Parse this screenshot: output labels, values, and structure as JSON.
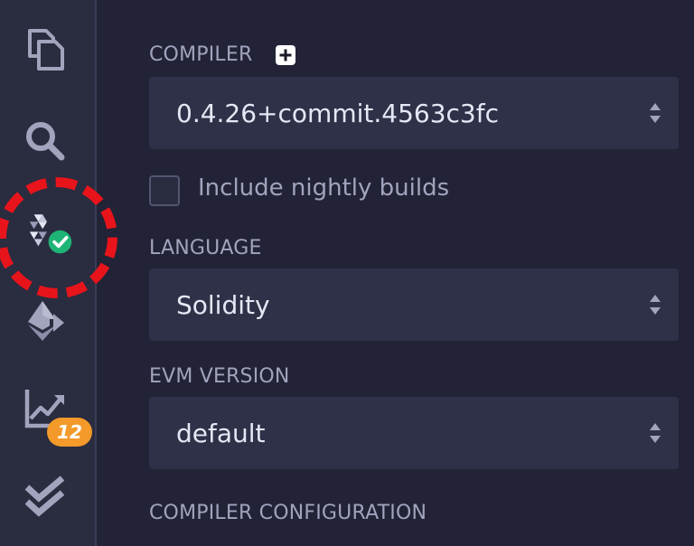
{
  "sidebar": {
    "icons": [
      {
        "name": "file-explorer-icon"
      },
      {
        "name": "search-icon"
      },
      {
        "name": "solidity-compiler-icon",
        "status": "success"
      },
      {
        "name": "deploy-run-icon"
      },
      {
        "name": "analysis-icon",
        "badge": "12"
      },
      {
        "name": "testing-icon"
      }
    ],
    "badge_count": "12",
    "badge_color": "#f39a2a",
    "highlight_color": "#e8141b"
  },
  "compiler": {
    "label": "COMPILER",
    "version": "0.4.26+commit.4563c3fc",
    "nightly_label": "Include nightly builds",
    "nightly_checked": false
  },
  "language": {
    "label": "LANGUAGE",
    "value": "Solidity"
  },
  "evm": {
    "label": "EVM VERSION",
    "value": "default"
  },
  "config": {
    "label": "COMPILER CONFIGURATION"
  }
}
